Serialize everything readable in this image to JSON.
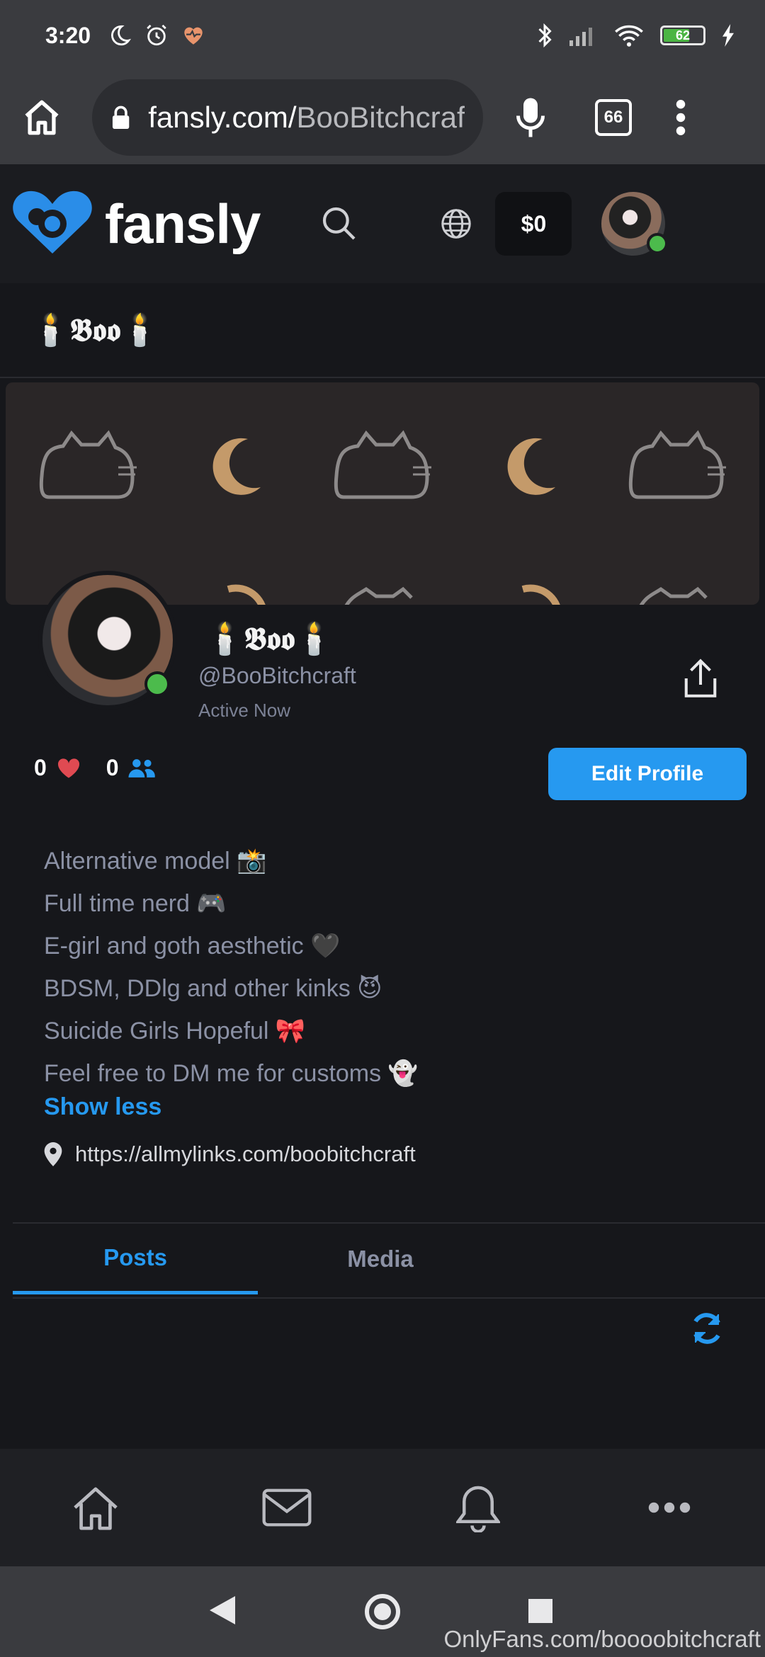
{
  "status_bar": {
    "time": "3:20",
    "battery": "62"
  },
  "browser": {
    "url_domain": "fansly.com/",
    "url_path": "BooBitchcraft",
    "tab_count": "66"
  },
  "site": {
    "logo_text": "fansly",
    "balance": "$0"
  },
  "profile": {
    "display_name": "🕯️𝕭𝖔𝖔🕯️",
    "handle": "@BooBitchcraft",
    "status": "Active Now",
    "likes": "0",
    "followers": "0",
    "edit_button": "Edit Profile",
    "bio": [
      "Alternative model 📸",
      "Full time nerd 🎮",
      "E-girl and goth aesthetic 🖤",
      "BDSM, DDlg and other kinks 😈",
      "Suicide Girls Hopeful 🎀",
      "Feel free to DM me for customs 👻"
    ],
    "show_less": "Show less",
    "link": "https://allmylinks.com/boobitchcraft"
  },
  "tabs": [
    "Posts",
    "Media"
  ],
  "colors": {
    "accent": "#2699f0",
    "online": "#4cbb4c",
    "heart": "#e04a52"
  },
  "watermark": "OnlyFans.com/boooobitchcraft"
}
